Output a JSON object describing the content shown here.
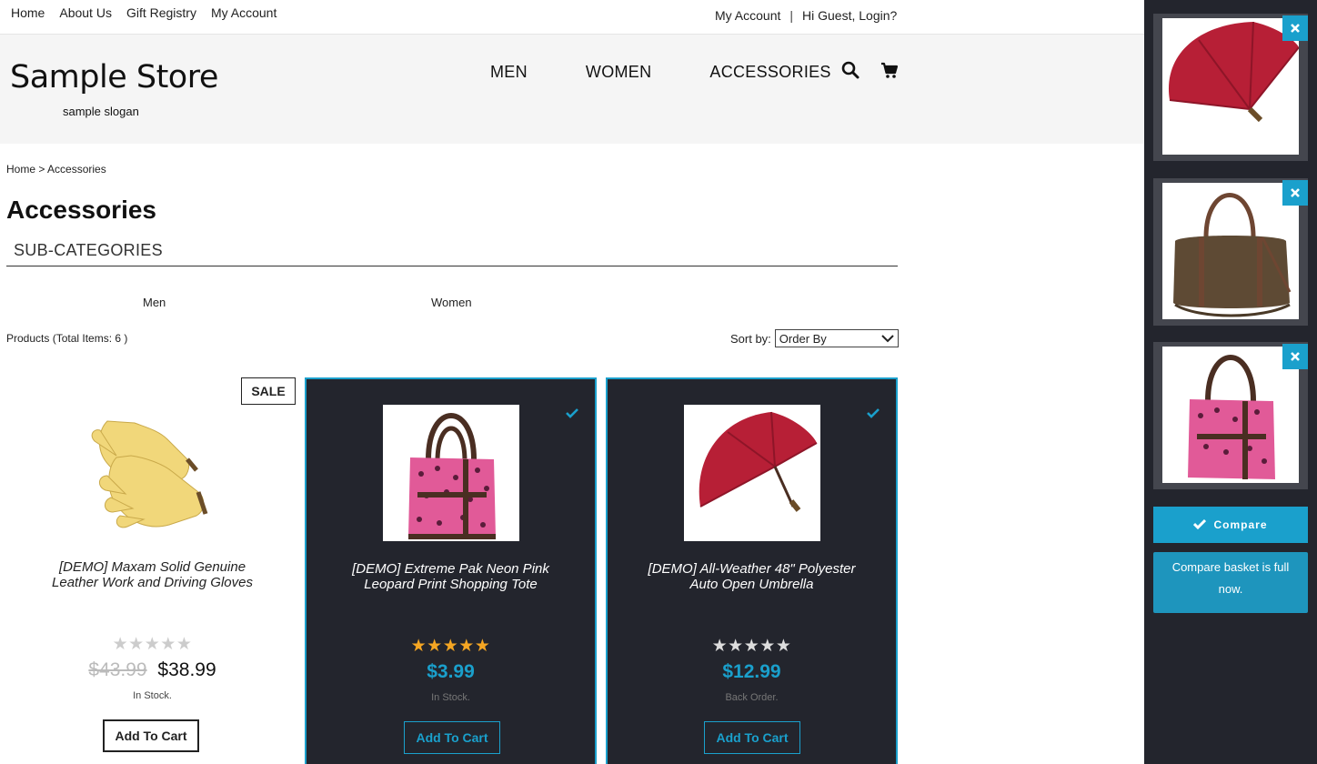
{
  "top_nav": {
    "items": [
      "Home",
      "About Us",
      "Gift Registry",
      "My Account"
    ],
    "account_label": "My Account",
    "separator": "|",
    "login_label": "Hi Guest, Login?"
  },
  "header": {
    "store_name": "Sample Store",
    "slogan": "sample slogan",
    "nav": [
      "MEN",
      "WOMEN",
      "ACCESSORIES"
    ]
  },
  "breadcrumb": {
    "home": "Home",
    "separator": ">",
    "current": "Accessories"
  },
  "page_title": "Accessories",
  "subcategories": {
    "heading": "SUB-CATEGORIES",
    "items": [
      "Men",
      "Women"
    ]
  },
  "products_bar": {
    "label": "Products",
    "count_text": "(Total Items: 6 )",
    "sort_label": "Sort by:",
    "sort_value": "Order By"
  },
  "products": [
    {
      "name_line1": "[DEMO] Maxam Solid Genuine",
      "name_line2": "Leather Work and Driving Gloves",
      "badge": "SALE",
      "rating": 0,
      "old_price": "$43.99",
      "price": "$38.99",
      "stock": "In Stock.",
      "cart_label": "Add To Cart",
      "selected": false,
      "image": "gloves"
    },
    {
      "name_line1": "[DEMO] Extreme Pak Neon Pink",
      "name_line2": "Leopard Print Shopping Tote",
      "rating": 5,
      "price": "$3.99",
      "stock": "In Stock.",
      "cart_label": "Add To Cart",
      "selected": true,
      "image": "pink-tote"
    },
    {
      "name_line1": "[DEMO] All-Weather 48\" Polyester",
      "name_line2": "Auto Open Umbrella",
      "rating": 0,
      "price": "$12.99",
      "stock": "Back Order.",
      "cart_label": "Add To Cart",
      "selected": true,
      "image": "red-umbrella"
    }
  ],
  "compare": {
    "items": [
      "red-umbrella",
      "brown-duffel-bag",
      "pink-tote"
    ],
    "button_label": "Compare",
    "full_message": "Compare basket is full now."
  },
  "colors": {
    "accent": "#1aa0cc",
    "dark_panel": "#23252d",
    "star_gold": "#f5a623",
    "header_bg": "#f5f5f5"
  },
  "icons": [
    "search-icon",
    "cart-icon",
    "check-icon",
    "close-icon",
    "star-icon",
    "chevron-down-icon"
  ]
}
